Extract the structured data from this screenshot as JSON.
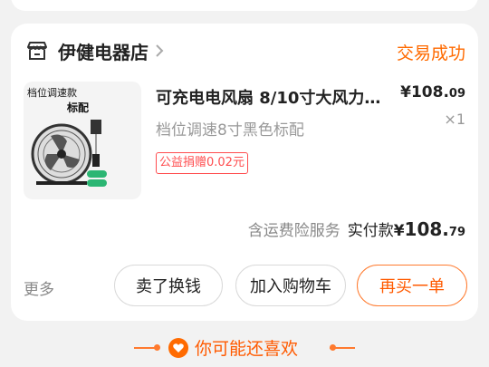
{
  "order": {
    "store_name": "伊健电器店",
    "status": "交易成功",
    "product": {
      "title": "可充电电风扇 8/10寸大风力…",
      "sku": "档位调速8寸黑色标配",
      "price_main": "¥108.",
      "price_cents": "09",
      "qty": "×1",
      "tag": "公益捐赠0.02元",
      "thumb_label": "档位调速款",
      "thumb_label2": "标配"
    },
    "summary": {
      "insurance": "含运费险服务",
      "paid_label": "实付款",
      "paid_currency": "¥",
      "paid_main": "108.",
      "paid_cents": "79"
    },
    "actions": {
      "more": "更多",
      "sell": "卖了换钱",
      "cart": "加入购物车",
      "rebuy": "再买一单"
    }
  },
  "recommend": {
    "title": "你可能还喜欢"
  },
  "colors": {
    "accent": "#ff6a00",
    "tag": "#ff4d4f"
  }
}
